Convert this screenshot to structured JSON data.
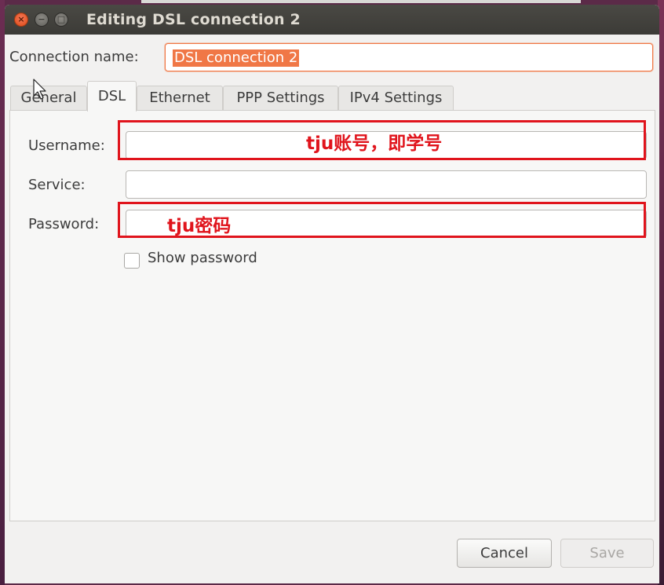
{
  "window": {
    "title": "Editing DSL connection 2",
    "controls": [
      "close-icon",
      "minimize-icon",
      "maximize-icon"
    ]
  },
  "connection": {
    "label": "Connection name:",
    "value": "DSL connection 2"
  },
  "tabs": [
    {
      "label": "General",
      "active": false
    },
    {
      "label": "DSL",
      "active": true
    },
    {
      "label": "Ethernet",
      "active": false
    },
    {
      "label": "PPP Settings",
      "active": false
    },
    {
      "label": "IPv4 Settings",
      "active": false
    }
  ],
  "dsl": {
    "username_label": "Username:",
    "username_value": "",
    "service_label": "Service:",
    "service_value": "",
    "password_label": "Password:",
    "password_value": "",
    "show_password_label": "Show password",
    "show_password_checked": false
  },
  "annotations": {
    "username_note": "tju账号，即学号",
    "password_note": "tju密码",
    "color": "#e0141c"
  },
  "buttons": {
    "cancel": "Cancel",
    "save": "Save",
    "save_enabled": false
  },
  "colors": {
    "accent": "#f07746",
    "titlebar": "#3c3b37",
    "annotation": "#e0141c"
  }
}
